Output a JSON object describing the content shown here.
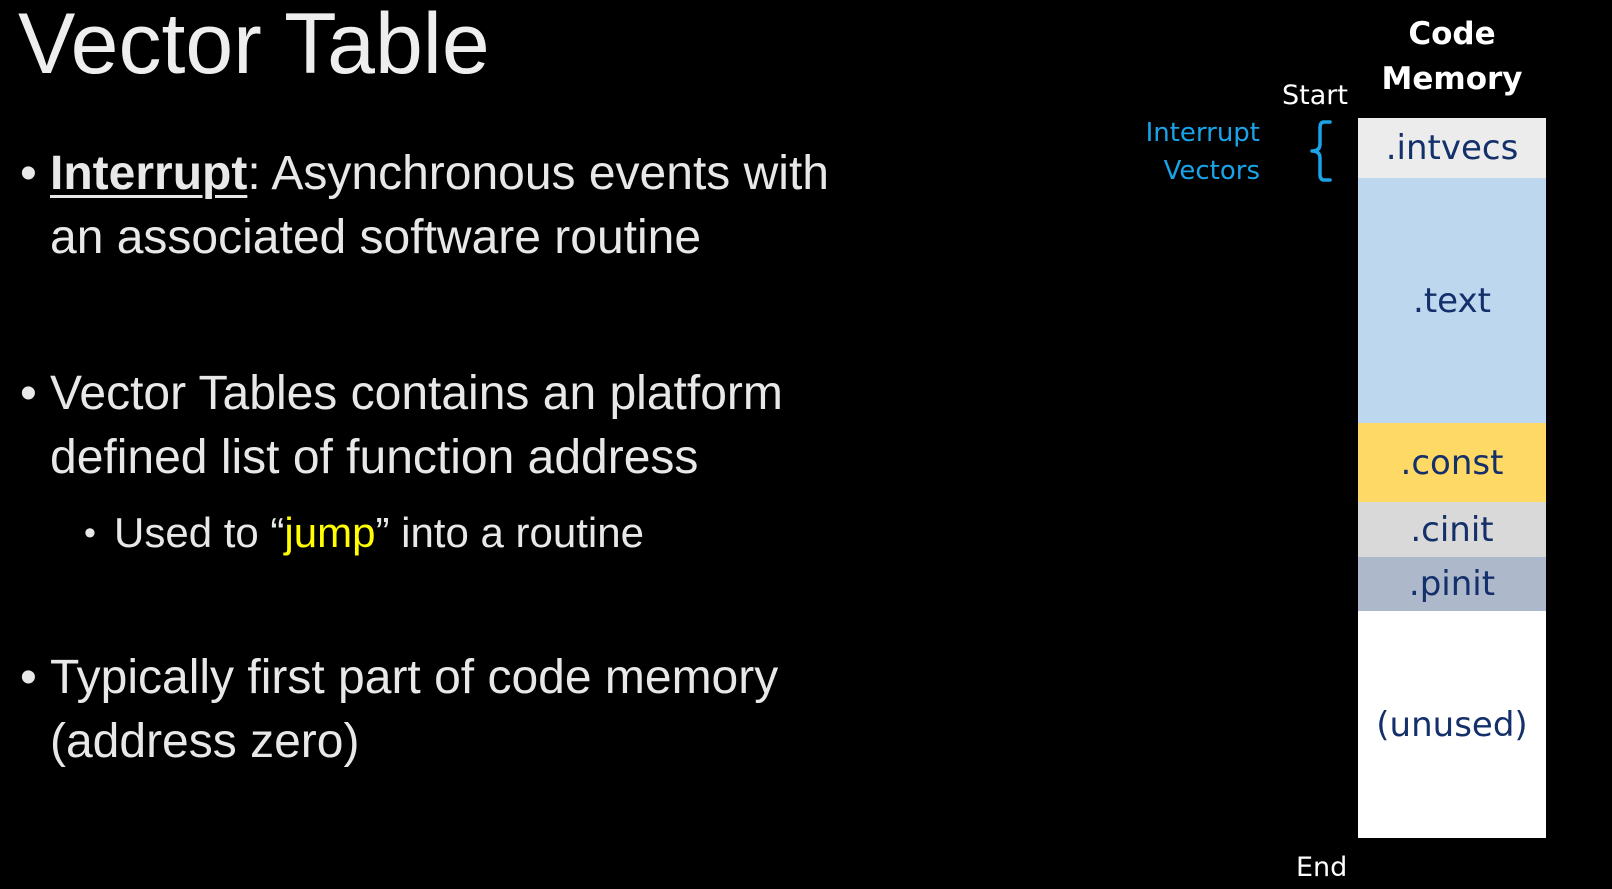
{
  "slide": {
    "title": "Vector Table"
  },
  "bullets": [
    {
      "dot": "•",
      "term": "Interrupt",
      "rest_line1": ": Asynchronous events with",
      "line2": "an associated software routine"
    },
    {
      "dot": "•",
      "line1": "Vector Tables contains an platform",
      "line2": "defined list of function address",
      "sub": {
        "dot": "•",
        "before": "Used to “",
        "highlight": "jump",
        "after": "” into a routine"
      }
    },
    {
      "dot": "•",
      "line1": "Typically first part of code memory",
      "line2": "(address zero)"
    }
  ],
  "diagram": {
    "title_line1": "Code",
    "title_line2": "Memory",
    "start_label": "Start",
    "end_label": "End",
    "bracket_label_line1": "Interrupt",
    "bracket_label_line2": "Vectors",
    "segments": [
      {
        "label": ".intvecs",
        "color": "#ececec"
      },
      {
        "label": ".text",
        "color": "#bdd7ee"
      },
      {
        "label": ".const",
        "color": "#ffd966"
      },
      {
        "label": ".cinit",
        "color": "#d9d9d9"
      },
      {
        "label": ".pinit",
        "color": "#adb9ca"
      },
      {
        "label": "(unused)",
        "color": "#ffffff"
      }
    ],
    "accent_color": "#1aa3e8"
  }
}
